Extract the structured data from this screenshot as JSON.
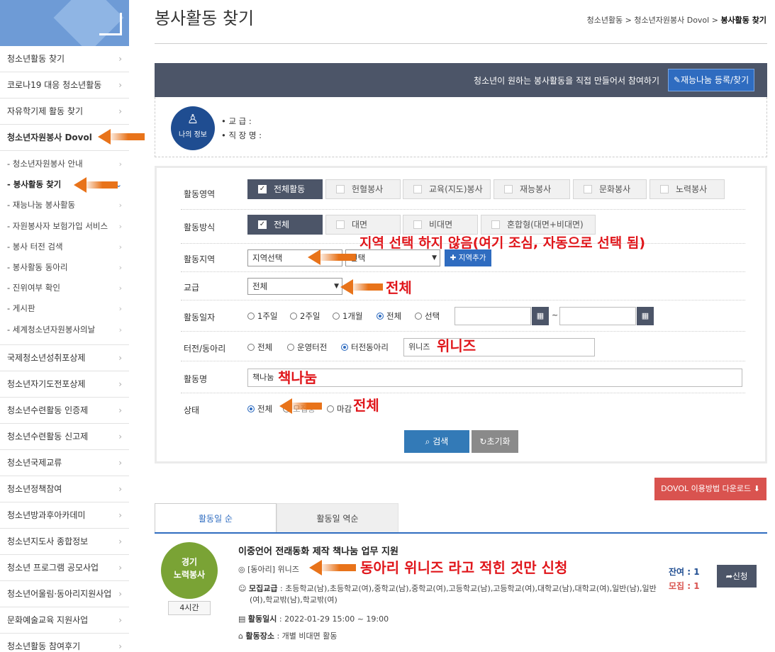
{
  "sidebar": {
    "items_top": [
      {
        "label": "청소년활동 찾기"
      },
      {
        "label": "코로나19 대응 청소년활동"
      },
      {
        "label": "자유학기제 활동 찾기"
      },
      {
        "label": "청소년자원봉사 Dovol"
      }
    ],
    "sub_items": [
      {
        "label": "- 청소년자원봉사 안내"
      },
      {
        "label": "- 봉사활동 찾기"
      },
      {
        "label": "- 재능나눔 봉사활동"
      },
      {
        "label": "- 자원봉사자 보험가입 서비스"
      },
      {
        "label": "- 봉사 터전 검색"
      },
      {
        "label": "- 봉사활동 동아리"
      },
      {
        "label": "- 진위여부 확인"
      },
      {
        "label": "- 게시판"
      },
      {
        "label": "- 세계청소년자원봉사의날"
      }
    ],
    "items_bottom": [
      {
        "label": "국제청소년성취포상제"
      },
      {
        "label": "청소년자기도전포상제"
      },
      {
        "label": "청소년수련활동 인증제"
      },
      {
        "label": "청소년수련활동 신고제"
      },
      {
        "label": "청소년국제교류"
      },
      {
        "label": "청소년정책참여"
      },
      {
        "label": "청소년방과후아카데미"
      },
      {
        "label": "청소년지도사 종합정보"
      },
      {
        "label": "청소년 프로그램 공모사업"
      },
      {
        "label": "청소년어울림·동아리지원사업"
      },
      {
        "label": "문화예술교육 지원사업"
      },
      {
        "label": "청소년활동 참여후기"
      }
    ]
  },
  "page": {
    "title": "봉사활동 찾기",
    "breadcrumb": "청소년활동 > 청소년자원봉사 Dovol > ",
    "breadcrumb_current": "봉사활동 찾기"
  },
  "banner": {
    "text": "청소년이 원하는 봉사활동을 직접 만들어서 참여하기",
    "button": "재능나눔 등록/찾기"
  },
  "myinfo": {
    "avatar_label": "나의 정보",
    "line1": "• 교    급    :",
    "line2": "• 직 장 명   :"
  },
  "form": {
    "area_label": "활동영역",
    "area_options": [
      "전체활동",
      "헌혈봉사",
      "교육(지도)봉사",
      "재능봉사",
      "문화봉사",
      "노력봉사"
    ],
    "method_label": "활동방식",
    "method_options": [
      "전체",
      "대면",
      "비대면",
      "혼합형(대면+비대면)"
    ],
    "region_label": "활동지역",
    "region_select1": "지역선택",
    "region_select2": "선택",
    "region_add": "✚ 지역추가",
    "grade_label": "교급",
    "grade_value": "전체",
    "date_label": "활동일자",
    "date_options": [
      "1주일",
      "2주일",
      "1개월",
      "전체",
      "선택"
    ],
    "date_sep": "~",
    "club_label": "터전/동아리",
    "club_options": [
      "전체",
      "운영터전",
      "터전동아리"
    ],
    "club_value": "위니즈",
    "name_label": "활동명",
    "name_value": "책나눔",
    "status_label": "상태",
    "status_options": [
      "전체",
      "모집중",
      "마감"
    ],
    "search_button": "검색",
    "reset_button": "초기화"
  },
  "annotations": {
    "region": "지역 선택 하지 않음(여기 조심, 자동으로 선택 됨)",
    "grade": "전체",
    "club": "위니즈",
    "name": "책나눔",
    "status": "전체",
    "result": "동아리 위니즈 라고 적힌 것만 신청"
  },
  "download_button": "DOVOL 이용방법 다운로드",
  "tabs": [
    "활동일 순",
    "활동일 역순"
  ],
  "result": {
    "region": "경기",
    "category": "노력봉사",
    "hours": "4시간",
    "title": "이중언어 전래동화 제작 책나눔 업무 지원",
    "club": "[동아리] 위니즈",
    "grade_label": "모집교급",
    "grade_value": ": 초등학교(남),초등학교(여),중학교(남),중학교(여),고등학교(남),고등학교(여),대학교(남),대학교(여),일반(남),일반",
    "grade_value2": "(여),학교밖(남),학교밖(여)",
    "date_label": "활동일시",
    "date_value": ": 2022-01-29   15:00 ~ 19:00",
    "place_label": "활동장소",
    "place_value": ": 개별 비대면 활동",
    "remain_label": "잔여 : 1",
    "recruit_label": "모집 : 1",
    "apply_button": "신청"
  }
}
